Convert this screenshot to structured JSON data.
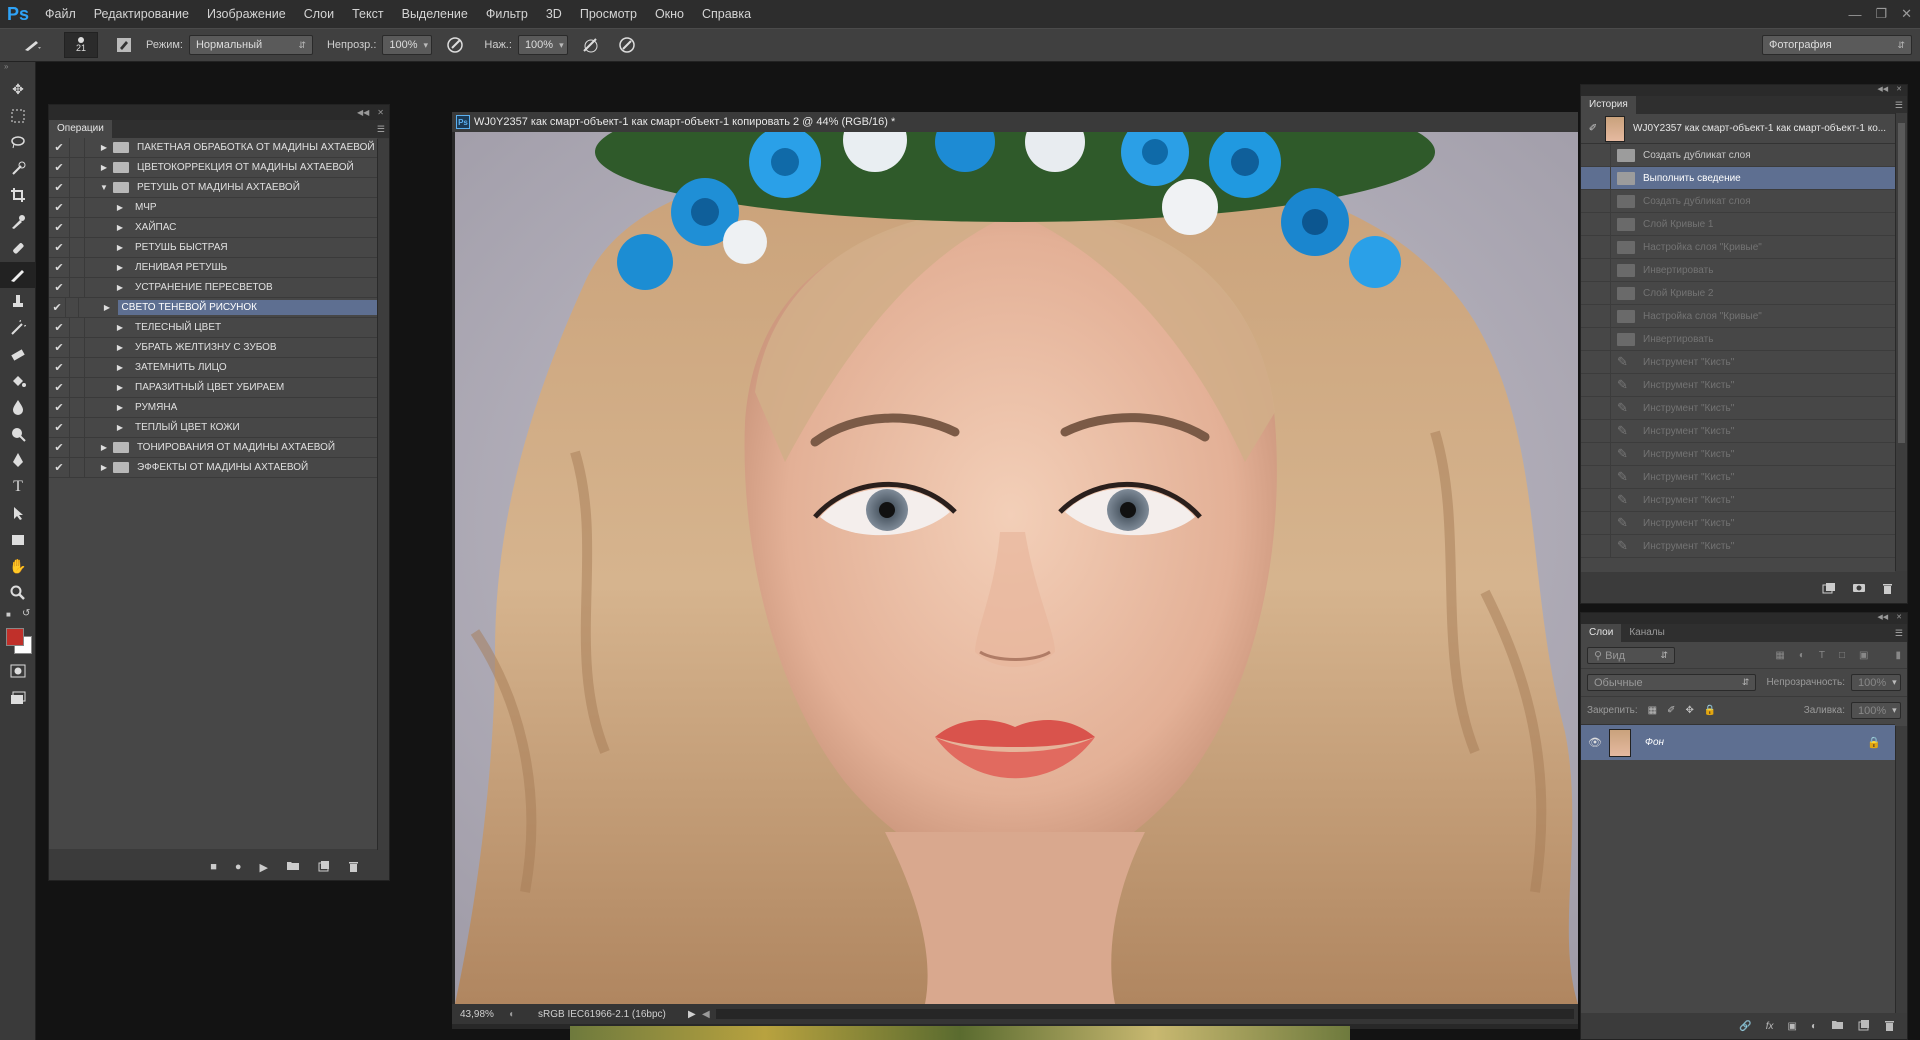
{
  "app": {
    "logo": "Ps"
  },
  "menu": [
    "Файл",
    "Редактирование",
    "Изображение",
    "Слои",
    "Текст",
    "Выделение",
    "Фильтр",
    "3D",
    "Просмотр",
    "Окно",
    "Справка"
  ],
  "options": {
    "brush_size": "21",
    "mode_label": "Режим:",
    "mode_value": "Нормальный",
    "opacity_label": "Непрозр.:",
    "opacity_value": "100%",
    "pressure_label": "Наж.:",
    "pressure_value": "100%",
    "workspace": "Фотография"
  },
  "actions_panel": {
    "tab": "Операции",
    "rows": [
      {
        "label": "ПАКЕТНАЯ ОБРАБОТКА ОТ МАДИНЫ АХТАЕВОЙ",
        "level": 0,
        "folder": true,
        "open": false
      },
      {
        "label": "ЦВЕТОКОРРЕКЦИЯ ОТ МАДИНЫ АХТАЕВОЙ",
        "level": 0,
        "folder": true,
        "open": false
      },
      {
        "label": "РЕТУШЬ ОТ МАДИНЫ АХТАЕВОЙ",
        "level": 0,
        "folder": true,
        "open": true
      },
      {
        "label": "МЧР",
        "level": 1
      },
      {
        "label": "ХАЙПАС",
        "level": 1
      },
      {
        "label": "РЕТУШЬ БЫСТРАЯ",
        "level": 1
      },
      {
        "label": "ЛЕНИВАЯ РЕТУШЬ",
        "level": 1
      },
      {
        "label": "УСТРАНЕНИЕ ПЕРЕСВЕТОВ",
        "level": 1
      },
      {
        "label": "СВЕТО ТЕНЕВОЙ РИСУНОК",
        "level": 1,
        "selected": true
      },
      {
        "label": "ТЕЛЕСНЫЙ ЦВЕТ",
        "level": 1
      },
      {
        "label": "УБРАТЬ ЖЕЛТИЗНУ С ЗУБОВ",
        "level": 1
      },
      {
        "label": "ЗАТЕМНИТЬ ЛИЦО",
        "level": 1
      },
      {
        "label": "ПАРАЗИТНЫЙ ЦВЕТ УБИРАЕМ",
        "level": 1
      },
      {
        "label": "РУМЯНА",
        "level": 1
      },
      {
        "label": "ТЕПЛЫЙ ЦВЕТ КОЖИ",
        "level": 1
      },
      {
        "label": "ТОНИРОВАНИЯ ОТ МАДИНЫ АХТАЕВОЙ",
        "level": 0,
        "folder": true,
        "open": false
      },
      {
        "label": "ЭФФЕКТЫ ОТ МАДИНЫ АХТАЕВОЙ",
        "level": 0,
        "folder": true,
        "open": false
      }
    ]
  },
  "document": {
    "title": "WJ0Y2357 как смарт-объект-1 как смарт-объект-1 копировать 2 @ 44% (RGB/16) *",
    "zoom": "43,98%",
    "profile": "sRGB IEC61966-2.1 (16bpc)"
  },
  "history_panel": {
    "tab": "История",
    "snapshot": "WJ0Y2357 как смарт-объект-1 как смарт-объект-1 ко...",
    "rows": [
      {
        "label": "Создать дубликат слоя",
        "state": "normal"
      },
      {
        "label": "Выполнить сведение",
        "state": "selected"
      },
      {
        "label": "Создать дубликат слоя",
        "state": "dim"
      },
      {
        "label": "Слой Кривые 1",
        "state": "dim"
      },
      {
        "label": "Настройка слоя \"Кривые\"",
        "state": "dim"
      },
      {
        "label": "Инвертировать",
        "state": "dim"
      },
      {
        "label": "Слой Кривые 2",
        "state": "dim"
      },
      {
        "label": "Настройка слоя \"Кривые\"",
        "state": "dim"
      },
      {
        "label": "Инвертировать",
        "state": "dim"
      },
      {
        "label": "Инструмент \"Кисть\"",
        "state": "dim"
      },
      {
        "label": "Инструмент \"Кисть\"",
        "state": "dim"
      },
      {
        "label": "Инструмент \"Кисть\"",
        "state": "dim"
      },
      {
        "label": "Инструмент \"Кисть\"",
        "state": "dim"
      },
      {
        "label": "Инструмент \"Кисть\"",
        "state": "dim"
      },
      {
        "label": "Инструмент \"Кисть\"",
        "state": "dim"
      },
      {
        "label": "Инструмент \"Кисть\"",
        "state": "dim"
      },
      {
        "label": "Инструмент \"Кисть\"",
        "state": "dim"
      },
      {
        "label": "Инструмент \"Кисть\"",
        "state": "dim"
      }
    ]
  },
  "layers_panel": {
    "tabs": [
      "Слои",
      "Каналы"
    ],
    "filter": "Вид",
    "blend": "Обычные",
    "opacity_label": "Непрозрачность:",
    "opacity_value": "100%",
    "lock_label": "Закрепить:",
    "fill_label": "Заливка:",
    "fill_value": "100%",
    "layers": [
      {
        "name": "Фон"
      }
    ]
  },
  "colors": {
    "foreground": "#c0302a",
    "background": "#ffffff",
    "accent": "#5e6f91"
  }
}
